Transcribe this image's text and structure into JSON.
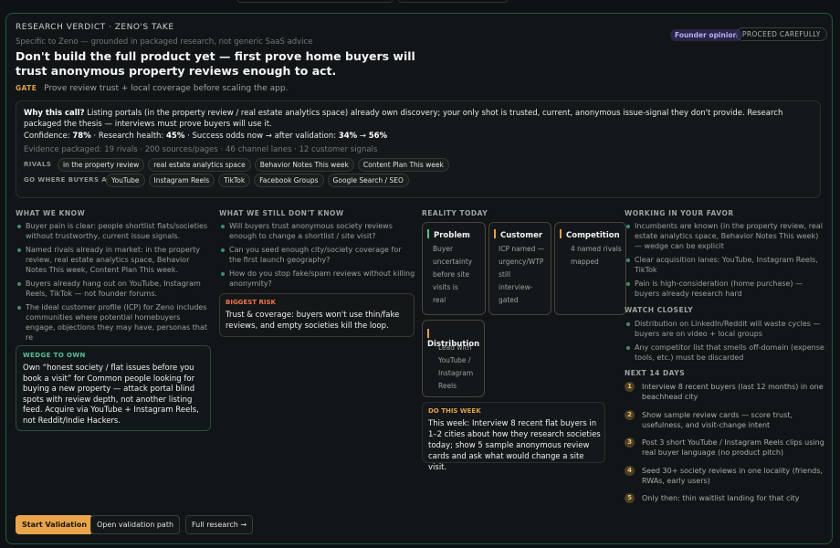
{
  "header": {
    "kicker": "RESEARCH VERDICT · ZENO'S TAKE",
    "subtitle": "Specific to Zeno — grounded in packaged research, not generic SaaS advice",
    "title": "Don't build the full product yet — first prove home buyers will trust anonymous property reviews enough to act.",
    "gate_label": "GATE",
    "gate_text": "Prove review trust + local coverage before scaling the app.",
    "founder_pill": "Founder opinion",
    "proceed_pill": "PROCEED CAREFULLY"
  },
  "why": {
    "lead": "Why this call?",
    "text": " Listing portals (in the property review / real estate analytics space) already own discovery; your only shot is trusted, current, anonymous issue-signal they don't provide. Research packaged the thesis — interviews must prove buyers will use it.",
    "confidence_label": "Confidence:",
    "confidence_value": "78%",
    "health_label": "· Research health:",
    "health_value": "45%",
    "odds_label": "· Success odds now → after validation:",
    "odds_now": "34%",
    "odds_arrow": "→",
    "odds_after": "56%",
    "evidence": "Evidence packaged: 19 rivals · 200 sources/pages · 46 channel lanes · 12 customer signals",
    "rivals_label": "RIVALS",
    "rivals": [
      "in the property review",
      "real estate analytics space",
      "Behavior Notes This week",
      "Content Plan This week"
    ],
    "go_label": "GO WHERE BUYERS ARE",
    "go": [
      "YouTube",
      "Instagram Reels",
      "TikTok",
      "Facebook Groups",
      "Google Search / SEO"
    ]
  },
  "know": {
    "heading": "WHAT WE KNOW",
    "items": [
      "Buyer pain is clear: people shortlist flats/societies without trustworthy, current issue signals.",
      "Named rivals already in market: in the property review, real estate analytics space, Behavior Notes This week, Content Plan This week.",
      "Buyers already hang out on YouTube, Instagram Reels, TikTok — not founder forums.",
      "The ideal customer profile (ICP) for Zeno includes communities where potential homebuyers engage, objections they may have, personas that re"
    ],
    "wedge_heading": "WEDGE TO OWN",
    "wedge_text": "Own “honest society / flat issues before you book a visit” for Common people looking for buying a new property — attack portal blind spots with review depth, not another listing feed. Acquire via YouTube + Instagram Reels, not Reddit/Indie Hackers."
  },
  "dont": {
    "heading": "WHAT WE STILL DON'T KNOW",
    "items": [
      "Will buyers trust anonymous society reviews enough to change a shortlist / site visit?",
      "Can you seed enough city/society coverage for the first launch geography?",
      "How do you stop fake/spam reviews without killing anonymity?"
    ],
    "risk_heading": "BIGGEST RISK",
    "risk_text": "Trust & coverage: buyers won't use thin/fake reviews, and empty societies kill the loop."
  },
  "reality": {
    "heading": "REALITY TODAY",
    "problem_title": "Problem",
    "problem_lines": [
      "Buyer",
      "uncertainty",
      "before site",
      "visits is",
      "real"
    ],
    "customer_title": "Customer",
    "customer_lines": [
      "ICP named —",
      "urgency/WTP",
      "still",
      "interview-",
      "gated"
    ],
    "competition_title": "Competition",
    "competition_lines": [
      "4 named rivals",
      "mapped"
    ],
    "distribution_title": "Distribution",
    "distribution_lines": [
      "Lead with",
      "YouTube /",
      "Instagram",
      "Reels"
    ],
    "dtw_heading": "DO THIS WEEK",
    "dtw_text": "This week: Interview 8 recent flat buyers in 1–2 cities about how they research societies today; show 5 sample anonymous review cards and ask what would change a site visit."
  },
  "favor": {
    "heading": "WORKING IN YOUR FAVOR",
    "items": [
      "Incumbents are known (in the property review, real estate analytics space, Behavior Notes This week) — wedge can be explicit",
      "Clear acquisition lanes: YouTube, Instagram Reels, TikTok",
      "Pain is high-consideration (home purchase) — buyers already research hard"
    ],
    "watch_heading": "WATCH CLOSELY",
    "watch_items": [
      "Distribution on LinkedIn/Reddit will waste cycles — buyers are on video + local groups",
      "Any competitor list that smells off-domain (expense tools, etc.) must be discarded"
    ],
    "next_heading": "NEXT 14 DAYS",
    "steps": [
      {
        "n": "1",
        "t": "Interview 8 recent buyers (last 12 months) in one beachhead city"
      },
      {
        "n": "2",
        "t": "Show sample review cards — score trust, usefulness, and visit-change intent"
      },
      {
        "n": "3",
        "t": "Post 3 short YouTube / Instagram Reels clips using real buyer language (no product pitch)"
      },
      {
        "n": "4",
        "t": "Seed 30+ society reviews in one locality (friends, RWAs, early users)"
      },
      {
        "n": "5",
        "t": "Only then: thin waitlist landing for that city"
      }
    ]
  },
  "actions": {
    "start": "Start Validation",
    "open": "Open validation path",
    "full": "Full research →"
  },
  "colors": {
    "accent": "#eaa54a",
    "border": "#1f5a45",
    "bullet": "#3f8d71",
    "risk": "#f0734f"
  }
}
